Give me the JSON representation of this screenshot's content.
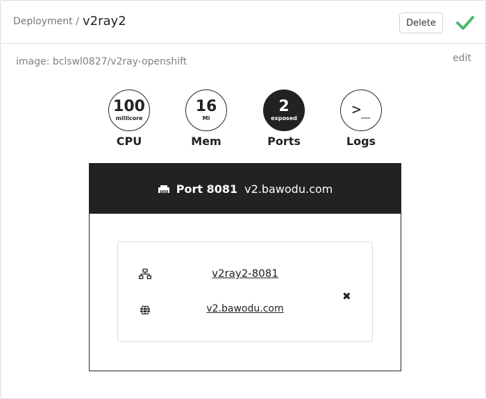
{
  "header": {
    "kind": "Deployment /",
    "name": "v2ray2",
    "delete_label": "Delete",
    "status_icon": "check-icon",
    "status_color": "#4bb870"
  },
  "image": {
    "text": "image: bclswl0827/v2ray-openshift",
    "edit_label": "edit"
  },
  "stats": {
    "cpu": {
      "value": "100",
      "unit": "millicore",
      "label": "CPU"
    },
    "mem": {
      "value": "16",
      "unit": "Mi",
      "label": "Mem"
    },
    "ports": {
      "value": "2",
      "unit": "exposed",
      "label": "Ports"
    },
    "logs": {
      "glyph": ">_",
      "label": "Logs"
    }
  },
  "port": {
    "title": "Port 8081",
    "host": "v2.bawodu.com",
    "icon": "ethernet-port-icon",
    "service": {
      "icon": "network-icon",
      "name": "v2ray2-8081",
      "remove_icon": "close-icon"
    },
    "route": {
      "icon": "globe-icon",
      "host": "v2.bawodu.com"
    }
  },
  "colors": {
    "dark": "#222222",
    "muted": "#808080",
    "success": "#4bb870"
  }
}
